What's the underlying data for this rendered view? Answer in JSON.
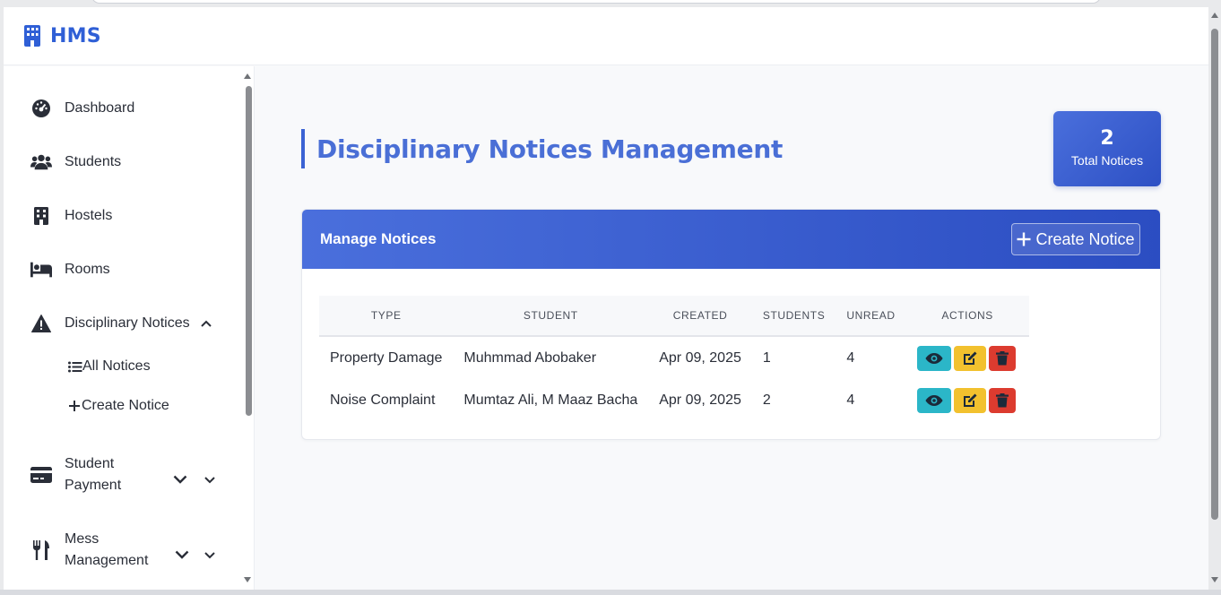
{
  "app": {
    "brand": "HMS"
  },
  "sidebar": {
    "items": [
      {
        "label": "Dashboard",
        "icon": "gauge-icon"
      },
      {
        "label": "Students",
        "icon": "users-icon"
      },
      {
        "label": "Hostels",
        "icon": "building-icon"
      },
      {
        "label": "Rooms",
        "icon": "bed-icon"
      },
      {
        "label": "Disciplinary Notices",
        "icon": "warning-icon",
        "expanded": true
      },
      {
        "label_line1": "Student",
        "label_line2": "Payment",
        "icon": "credit-card-icon"
      },
      {
        "label_line1": "Mess",
        "label_line2": "Management",
        "icon": "utensils-icon"
      }
    ],
    "sub_items": [
      {
        "label": "All Notices",
        "icon": "list-icon"
      },
      {
        "label": "Create Notice",
        "icon": "plus-icon"
      }
    ]
  },
  "main": {
    "title": "Disciplinary Notices Management",
    "stat": {
      "value": "2",
      "label": "Total Notices"
    },
    "card": {
      "title": "Manage Notices",
      "create_button": "Create Notice"
    },
    "table": {
      "headers": [
        "TYPE",
        "STUDENT",
        "CREATED",
        "STUDENTS",
        "UNREAD",
        "ACTIONS"
      ],
      "rows": [
        {
          "type": "Property Damage",
          "student": "Muhmmad Abobaker",
          "created": "Apr 09, 2025",
          "students": "1",
          "unread": "4"
        },
        {
          "type": "Noise Complaint",
          "student": "Mumtaz Ali, M Maaz Bacha",
          "created": "Apr 09, 2025",
          "students": "2",
          "unread": "4"
        }
      ]
    }
  },
  "colors": {
    "accent": "#2f5fd6",
    "header_gradient_start": "#4a6fdc",
    "header_gradient_end": "#2b4dc2",
    "view": "#2bb6c8",
    "edit": "#f2c12e",
    "delete": "#dc3b2f"
  }
}
